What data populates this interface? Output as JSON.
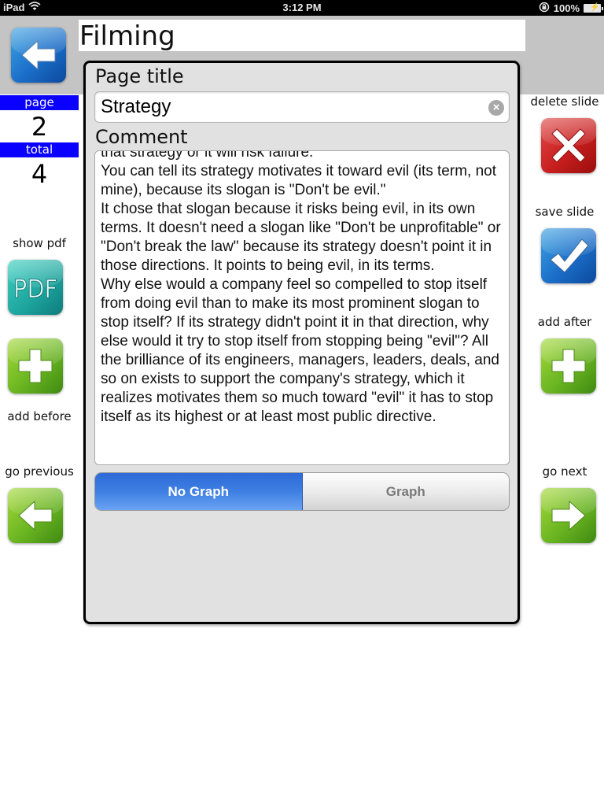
{
  "status_bar": {
    "device": "iPad",
    "time": "3:12 PM",
    "battery": "100%"
  },
  "header": {
    "title": "Filming"
  },
  "counters": {
    "page_label": "page",
    "page_value": "2",
    "total_label": "total",
    "total_value": "4"
  },
  "left_actions": {
    "back": {
      "icon": "back-arrow-icon"
    },
    "show_pdf": {
      "label": "show pdf",
      "icon": "pdf-icon",
      "icon_text": "PDF"
    },
    "add_before": {
      "label": "add before",
      "icon": "plus-icon"
    },
    "go_previous": {
      "label": "go previous",
      "icon": "left-arrow-icon"
    }
  },
  "right_actions": {
    "delete_slide": {
      "label": "delete slide",
      "icon": "x-icon"
    },
    "save_slide": {
      "label": "save slide",
      "icon": "checkmark-icon"
    },
    "add_after": {
      "label": "add after",
      "icon": "plus-icon"
    },
    "go_next": {
      "label": "go next",
      "icon": "right-arrow-icon"
    }
  },
  "form": {
    "page_title_label": "Page title",
    "page_title_value": "Strategy",
    "comment_label": "Comment",
    "comment_value": "that strategy or it will risk failure.\nYou can tell its strategy motivates it toward evil (its term, not mine), because its slogan is \"Don't be evil.\"\nIt chose that slogan because it risks being evil, in its own terms. It doesn't need a slogan like \"Don't be unprofitable\" or \"Don't break the law\" because its strategy doesn't point it in those directions. It points to being evil, in its terms.\nWhy else would a company feel so compelled to stop itself from doing evil than to make its most prominent slogan to stop itself? If its strategy didn't point it in that direction, why else would it try to stop itself from stopping being \"evil\"? All the brilliance of its engineers, managers, leaders, deals, and so on exists to support the company's strategy, which it realizes motivates them so much toward \"evil\" it has to stop itself as its highest or at least most public directive."
  },
  "graph_toggle": {
    "options": [
      "No Graph",
      "Graph"
    ],
    "selected": "No Graph"
  },
  "colors": {
    "counter_header": "#0a00ff",
    "segment_active": "#3f7fe2",
    "panel_bg": "#e1e1e1",
    "top_strip": "#c4c4c4"
  }
}
